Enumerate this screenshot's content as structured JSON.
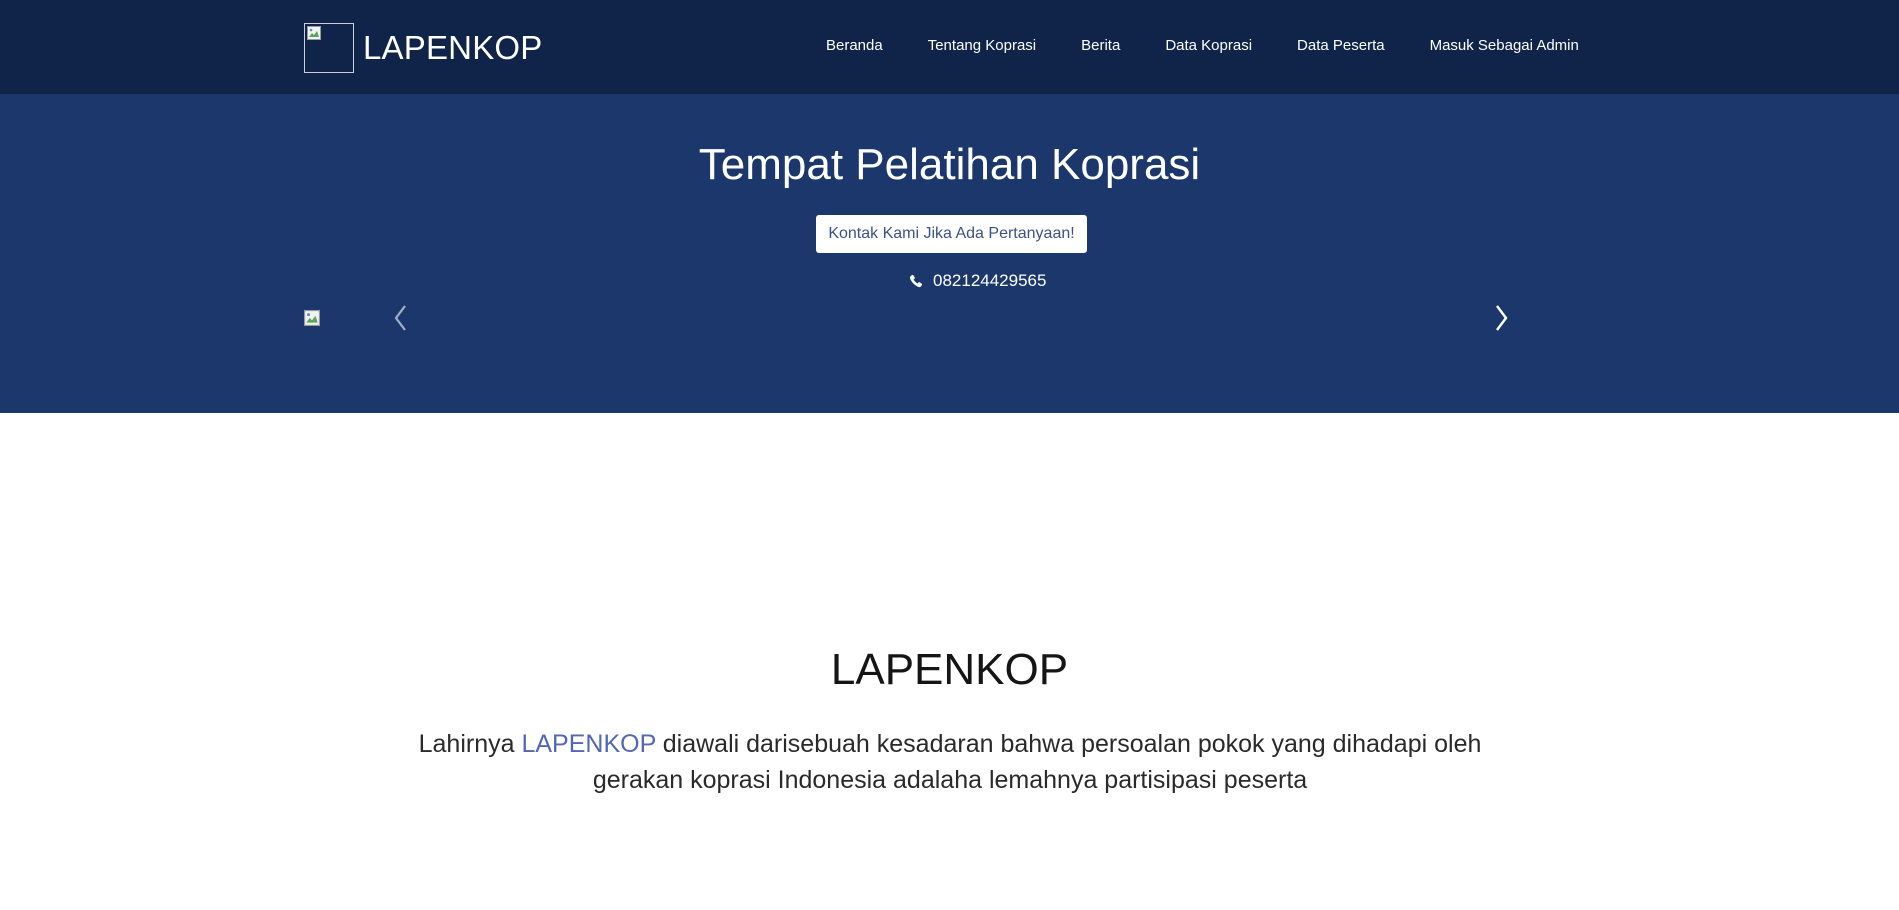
{
  "navbar": {
    "brand": "LAPENKOP",
    "links": [
      "Beranda",
      "Tentang Koprasi",
      "Berita",
      "Data Koprasi",
      "Data Peserta",
      "Masuk Sebagai Admin"
    ]
  },
  "hero": {
    "title": "Tempat Pelatihan Koprasi",
    "contact_button": "Kontak Kami Jika Ada Pertanyaan!",
    "phone": "082124429565"
  },
  "about": {
    "title": "LAPENKOP",
    "text_before": "Lahirnya ",
    "text_highlight": "LAPENKOP",
    "text_after": " diawali darisebuah kesadaran bahwa persoalan pokok yang dihadapi oleh gerakan koprasi Indonesia adalaha lemahnya partisipasi peserta"
  },
  "colors": {
    "navbar_bg": "#0f2448",
    "hero_bg": "#1b376b",
    "accent": "#5366b8"
  },
  "icons": [
    "broken-image-icon",
    "phone-icon",
    "chevron-left-icon",
    "chevron-right-icon"
  ]
}
